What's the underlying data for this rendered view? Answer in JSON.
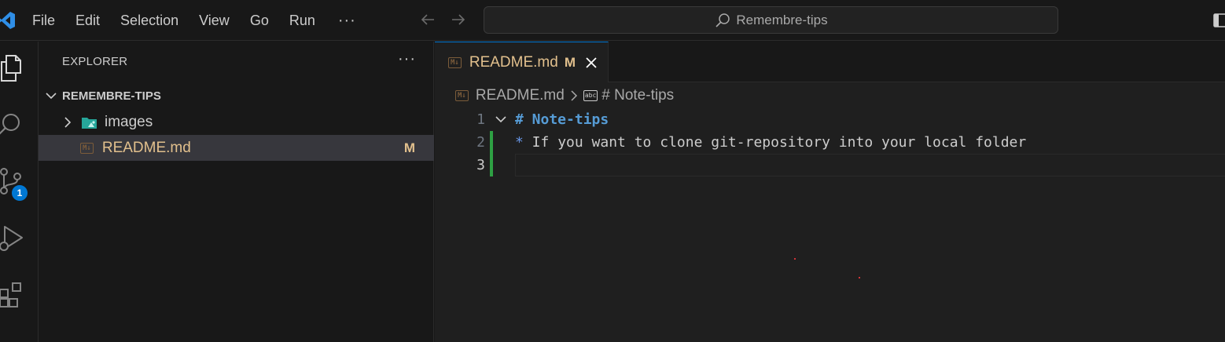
{
  "menu": [
    "File",
    "Edit",
    "Selection",
    "View",
    "Go",
    "Run"
  ],
  "menu_more": "···",
  "command_center": {
    "text": "Remembre-tips"
  },
  "activity": {
    "scm_badge": "1"
  },
  "sidebar": {
    "title": "EXPLORER",
    "more": "···",
    "folder": "REMEMBRE-TIPS",
    "items": [
      {
        "label": "images",
        "type": "folder",
        "color": "#cccccc",
        "status": ""
      },
      {
        "label": "README.md",
        "type": "file",
        "color": "#e2c08d",
        "status": "M"
      }
    ]
  },
  "editor": {
    "tab": {
      "label": "README.md",
      "status": "M",
      "icon_text": "M↓"
    },
    "breadcrumb": {
      "file": "README.md",
      "symbol": "# Note-tips",
      "symbol_icon_text": "abc"
    },
    "lines": [
      {
        "num": "1",
        "text": "# Note-tips"
      },
      {
        "num": "2",
        "bullet": "*",
        "text": " If you want to clone git-repository into your local folder"
      },
      {
        "num": "3",
        "text": ""
      }
    ]
  }
}
